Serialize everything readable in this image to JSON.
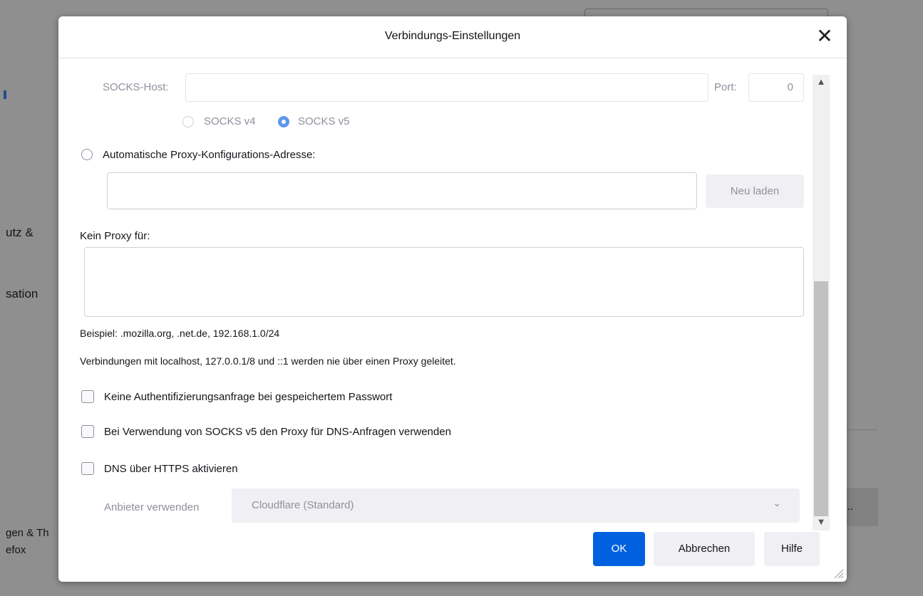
{
  "background": {
    "left_texts": [
      "utz &",
      "sation",
      "gen & Th",
      "efox"
    ],
    "right_button": "..."
  },
  "dialog": {
    "title": "Verbindungs-Einstellungen",
    "close_glyph": "✕",
    "socks": {
      "host_label": "SOCKS-Host:",
      "host_value": "",
      "port_label": "Port:",
      "port_value": "0",
      "v4_label": "SOCKS v4",
      "v5_label": "SOCKS v5",
      "selected": "SOCKS v5"
    },
    "auto_proxy": {
      "label": "Automatische Proxy-Konfigurations-Adresse:",
      "url_value": "",
      "reload_label": "Neu laden"
    },
    "no_proxy": {
      "label": "Kein Proxy für:",
      "value": "",
      "example": "Beispiel: .mozilla.org, .net.de, 192.168.1.0/24",
      "localhost_note": "Verbindungen mit localhost, 127.0.0.1/8 und ::1 werden nie über einen Proxy geleitet."
    },
    "checkboxes": [
      {
        "label": "Keine Authentifizierungsanfrage bei gespeichertem Passwort",
        "checked": false
      },
      {
        "label": "Bei Verwendung von SOCKS v5 den Proxy für DNS-Anfragen verwenden",
        "checked": false
      },
      {
        "label": "DNS über HTTPS aktivieren",
        "checked": false
      }
    ],
    "provider": {
      "label": "Anbieter verwenden",
      "selected": "Cloudflare (Standard)"
    },
    "buttons": {
      "ok": "OK",
      "cancel": "Abbrechen",
      "help": "Hilfe"
    }
  },
  "colors": {
    "accent": "#0061e0",
    "disabled_text": "#8f8f9d"
  }
}
